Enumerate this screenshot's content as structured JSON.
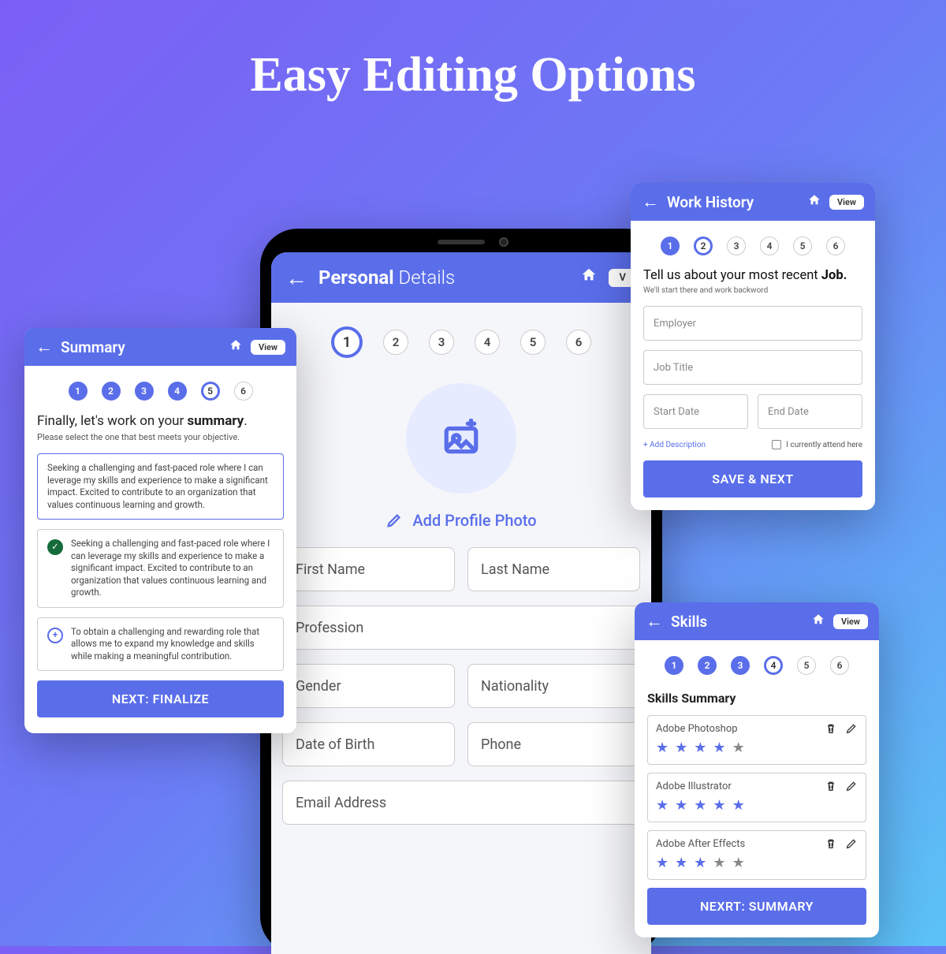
{
  "page_title": "Easy Editing Options",
  "phone": {
    "appbar_title_bold": "Personal",
    "appbar_title_light": "Details",
    "steps": [
      1,
      2,
      3,
      4,
      5,
      6
    ],
    "active_step": 1,
    "add_photo_label": "Add Profile Photo",
    "fields": {
      "first_name": "First Name",
      "last_name": "Last Name",
      "profession": "Profession",
      "gender": "Gender",
      "nationality": "Nationality",
      "dob": "Date of Birth",
      "phone": "Phone",
      "email": "Email Address"
    }
  },
  "summary": {
    "title": "Summary",
    "view_label": "View",
    "steps": [
      1,
      2,
      3,
      4,
      5,
      6
    ],
    "current": 5,
    "heading_pre": "Finally, let's work on your ",
    "heading_bold": "summary",
    "heading_post": ".",
    "sub": "Please select the one that best meets your objective.",
    "options": [
      "Seeking a challenging and fast-paced role where I can leverage my skills and experience to make a significant impact. Excited to contribute to an organization that values continuous learning and growth.",
      "Seeking a challenging and fast-paced role where I can leverage my skills and experience to make a significant impact. Excited to contribute to an organization that values continuous learning and growth.",
      "To obtain a challenging and rewarding role that allows me to expand my knowledge and skills while making a meaningful contribution."
    ],
    "next_label": "NEXT: FINALIZE"
  },
  "work": {
    "title": "Work History",
    "view_label": "View",
    "steps": [
      1,
      2,
      3,
      4,
      5,
      6
    ],
    "current": 2,
    "filled_upto": 1,
    "heading_pre": "Tell us about your most recent ",
    "heading_bold": "Job.",
    "sub": "We'll start there and work backword",
    "employer_ph": "Employer",
    "jobtitle_ph": "Job Title",
    "start_ph": "Start Date",
    "end_ph": "End Date",
    "add_desc": "+ Add Description",
    "attend_label": "I currently attend here",
    "save_label": "SAVE & NEXT"
  },
  "skills": {
    "title": "Skills",
    "view_label": "View",
    "steps": [
      1,
      2,
      3,
      4,
      5,
      6
    ],
    "current": 4,
    "filled_upto": 3,
    "heading": "Skills Summary",
    "items": [
      {
        "name": "Adobe Photoshop",
        "rating": 4
      },
      {
        "name": "Adobe Illustrator",
        "rating": 5
      },
      {
        "name": "Adobe After Effects",
        "rating": 3
      }
    ],
    "next_label": "NEXRT: SUMMARY"
  }
}
